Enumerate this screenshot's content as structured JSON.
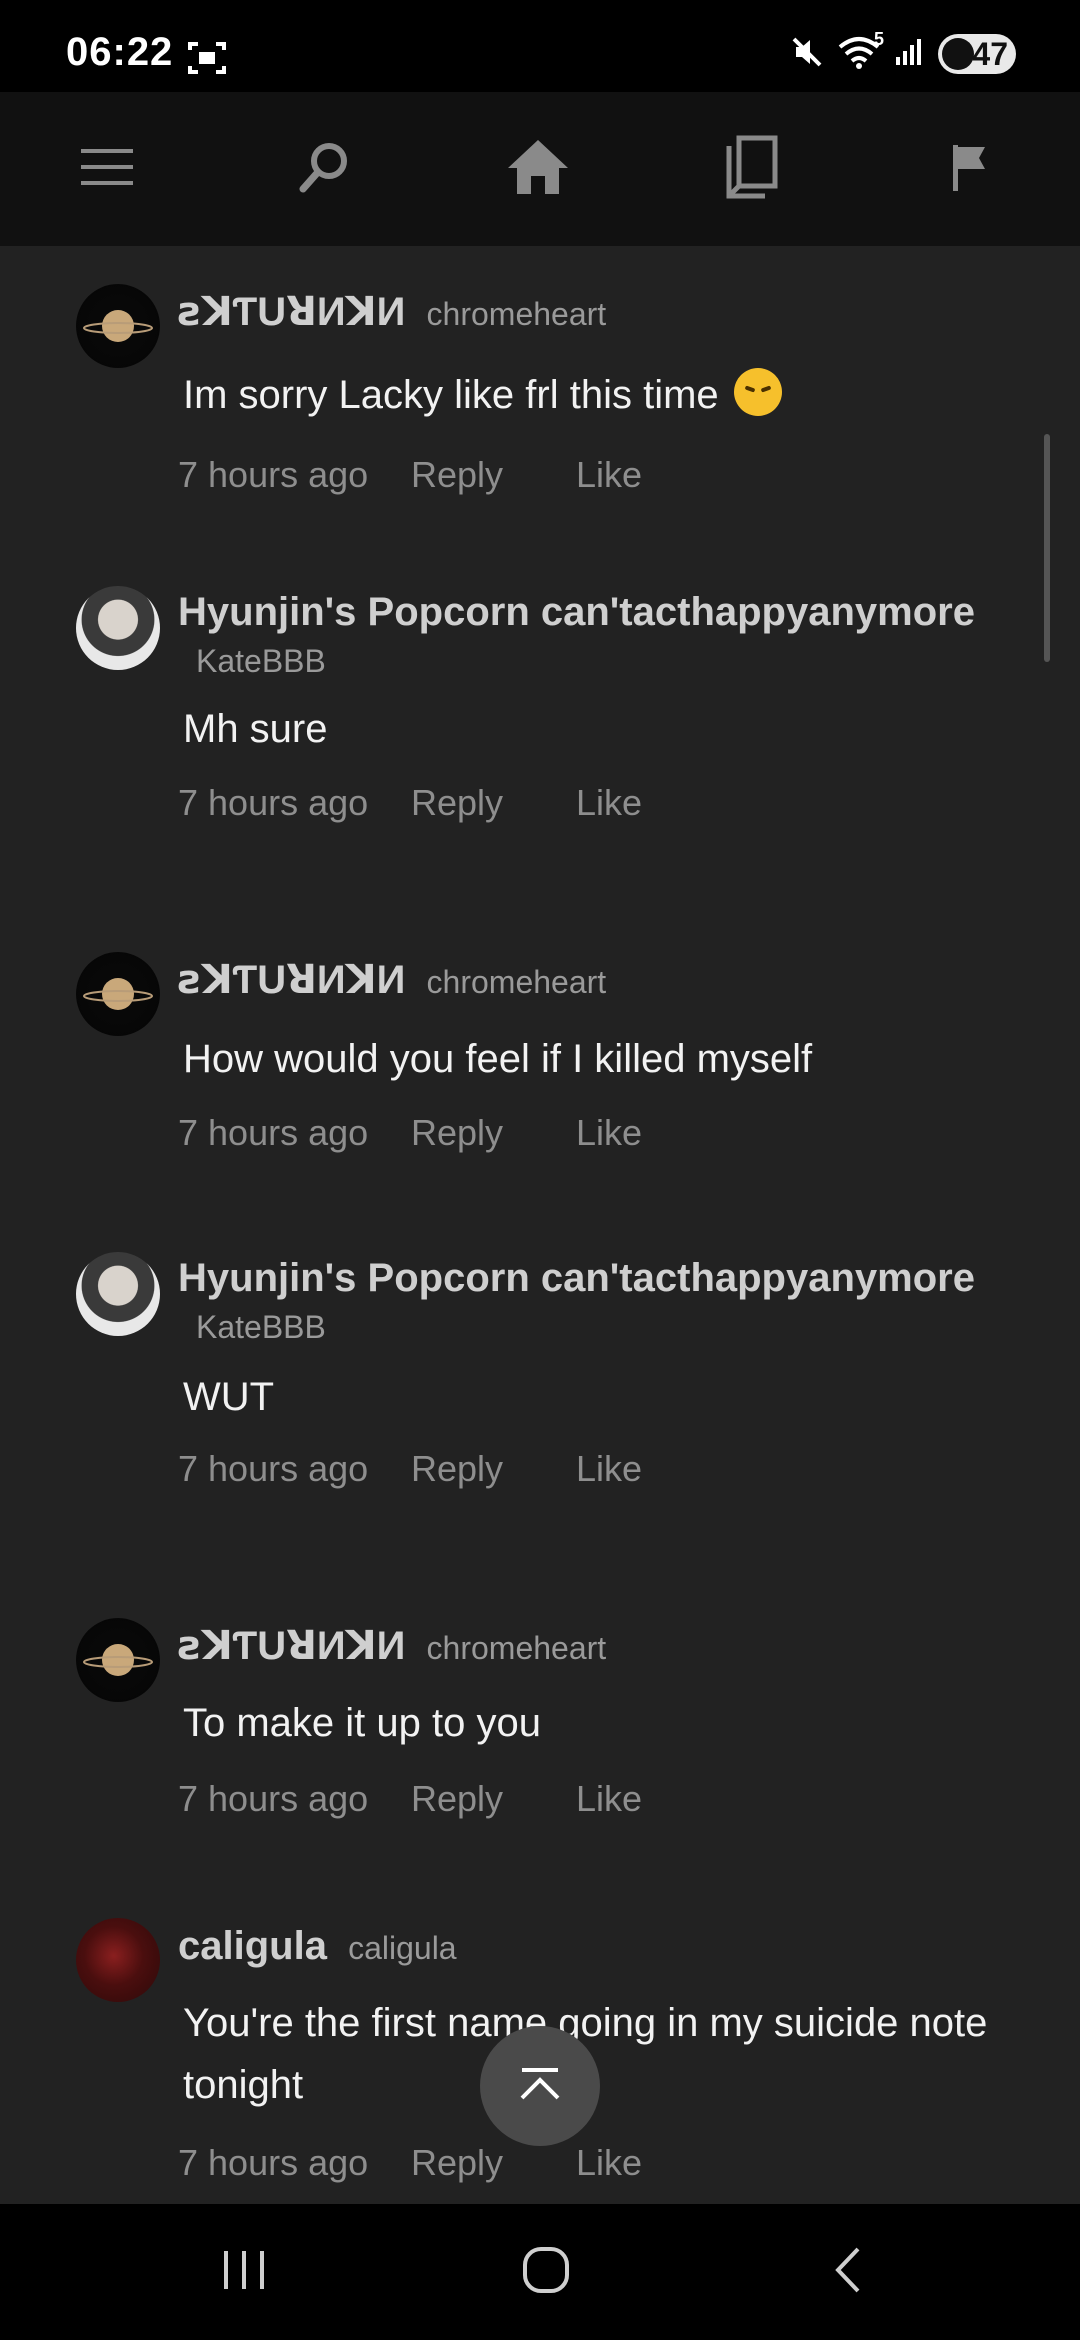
{
  "status_bar": {
    "time": "06:22",
    "battery": "47",
    "network_label": "5"
  },
  "top_nav": {
    "items": [
      {
        "name": "menu-icon"
      },
      {
        "name": "search-icon"
      },
      {
        "name": "home-icon"
      },
      {
        "name": "library-icon"
      },
      {
        "name": "flag-icon"
      }
    ]
  },
  "comments": [
    {
      "display_name": "ꙅꓘƬUꓤИꓘИ",
      "username": "chromeheart",
      "avatar": "saturn-avatar",
      "text": "Im sorry Lacky like frl this time",
      "emoji": "disappointed-face-emoji",
      "time": "7 hours ago",
      "reply": "Reply",
      "like": "Like"
    },
    {
      "display_name": "Hyunjin's Popcorn can'tacthappyanymore",
      "username": "KateBBB",
      "avatar": "popcorn-avatar",
      "text": "Mh sure",
      "time": "7 hours ago",
      "reply": "Reply",
      "like": "Like"
    },
    {
      "display_name": "ꙅꓘƬUꓤИꓘИ",
      "username": "chromeheart",
      "avatar": "saturn-avatar",
      "text": "How would you feel if I killed myself",
      "time": "7 hours ago",
      "reply": "Reply",
      "like": "Like"
    },
    {
      "display_name": "Hyunjin's Popcorn can'tacthappyanymore",
      "username": "KateBBB",
      "avatar": "popcorn-avatar",
      "text": "WUT",
      "time": "7 hours ago",
      "reply": "Reply",
      "like": "Like"
    },
    {
      "display_name": "ꙅꓘƬUꓤИꓘИ",
      "username": "chromeheart",
      "avatar": "saturn-avatar",
      "text": "To make it up to you",
      "time": "7 hours ago",
      "reply": "Reply",
      "like": "Like"
    },
    {
      "display_name": "caligula",
      "username": "caligula",
      "avatar": "caligula-avatar",
      "text": "You're the first name going in my suicide note tonight",
      "time": "7 hours ago",
      "reply": "Reply",
      "like": "Like"
    }
  ],
  "colors": {
    "background": "#222222",
    "nav_background": "#111111",
    "text_primary": "#f2f2f2",
    "text_secondary": "#8e8e8e"
  }
}
